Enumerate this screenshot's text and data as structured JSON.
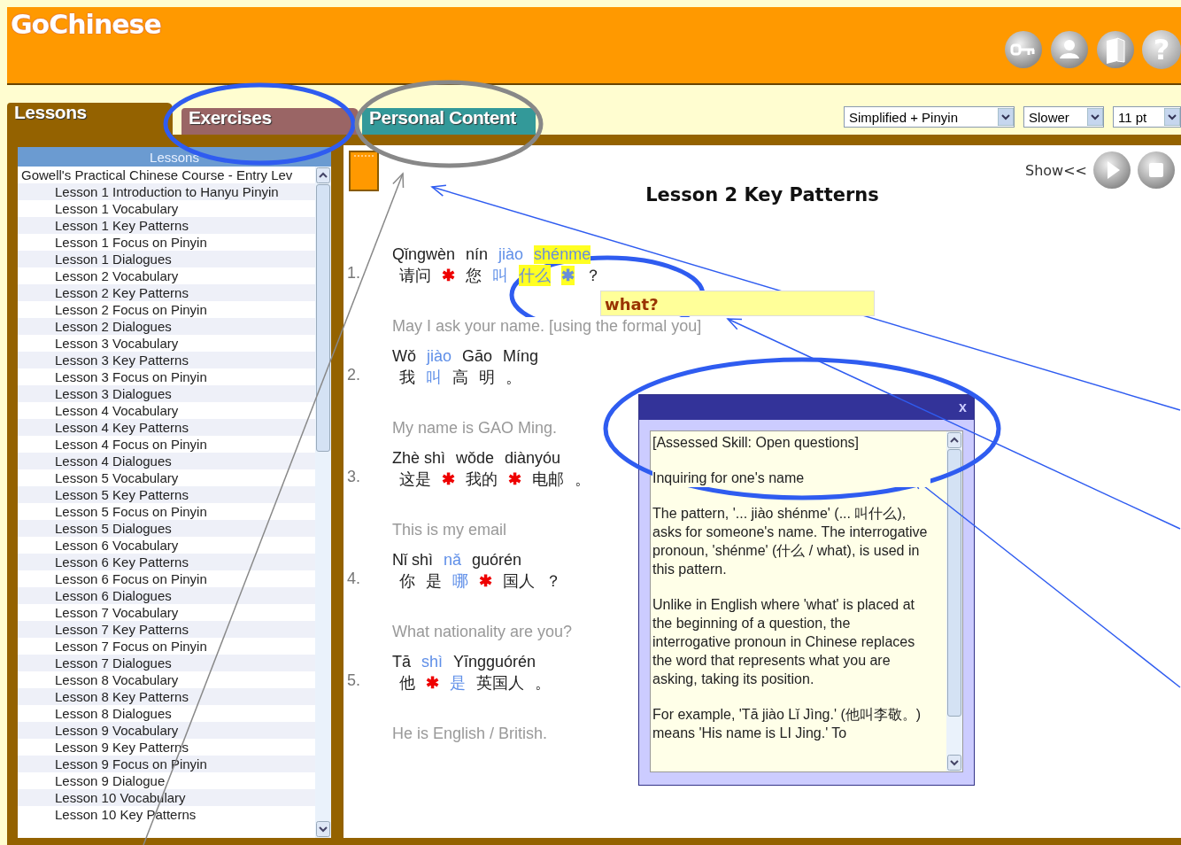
{
  "app": {
    "logo": "GoChinese",
    "help_button": "?"
  },
  "tabs": [
    {
      "label": "Lessons",
      "selected": true,
      "color": "#946200"
    },
    {
      "label": "Exercises",
      "selected": false,
      "color": "#9a6565"
    },
    {
      "label": "Personal Content",
      "selected": false,
      "color": "#339999"
    }
  ],
  "settings": [
    {
      "value": "Simplified + Pinyin"
    },
    {
      "value": "Slower"
    },
    {
      "value": "11 pt"
    }
  ],
  "sidebar": {
    "title": "Lessons",
    "items": [
      {
        "label": "Gowell's Practical Chinese Course - Entry Lev",
        "children": [
          {
            "label": "Lesson 1 Introduction to Hanyu Pinyin"
          },
          {
            "label": "Lesson 1 Vocabulary"
          },
          {
            "label": "Lesson 1 Key Patterns"
          },
          {
            "label": "Lesson 1 Focus on Pinyin"
          },
          {
            "label": "Lesson 1 Dialogues"
          },
          {
            "label": "Lesson 2 Vocabulary"
          },
          {
            "label": "Lesson 2 Key Patterns"
          },
          {
            "label": "Lesson 2 Focus on Pinyin"
          },
          {
            "label": "Lesson 2 Dialogues"
          },
          {
            "label": "Lesson 3 Vocabulary"
          },
          {
            "label": "Lesson 3 Key Patterns"
          },
          {
            "label": "Lesson 3 Focus on Pinyin"
          },
          {
            "label": "Lesson 3 Dialogues"
          },
          {
            "label": "Lesson 4 Vocabulary"
          },
          {
            "label": "Lesson 4 Key Patterns"
          },
          {
            "label": "Lesson 4 Focus on Pinyin"
          },
          {
            "label": "Lesson 4 Dialogues"
          },
          {
            "label": "Lesson 5 Vocabulary"
          },
          {
            "label": "Lesson 5 Key Patterns"
          },
          {
            "label": "Lesson 5 Focus on Pinyin"
          },
          {
            "label": "Lesson 5 Dialogues"
          },
          {
            "label": "Lesson 6 Vocabulary"
          },
          {
            "label": "Lesson 6 Key Patterns"
          },
          {
            "label": "Lesson 6 Focus on Pinyin"
          },
          {
            "label": "Lesson 6 Dialogues"
          },
          {
            "label": "Lesson 7 Vocabulary"
          },
          {
            "label": "Lesson 7 Key Patterns"
          },
          {
            "label": "Lesson 7 Focus on Pinyin"
          },
          {
            "label": "Lesson 7 Dialogues"
          },
          {
            "label": "Lesson 8 Vocabulary"
          },
          {
            "label": "Lesson 8 Key Patterns"
          },
          {
            "label": "Lesson 8 Dialogues"
          },
          {
            "label": "Lesson 9 Vocabulary"
          },
          {
            "label": "Lesson 9 Key Patterns"
          },
          {
            "label": "Lesson 9 Focus on Pinyin"
          },
          {
            "label": "Lesson 9 Dialogue"
          },
          {
            "label": "Lesson 10 Vocabulary"
          },
          {
            "label": "Lesson 10 Key Patterns"
          }
        ]
      }
    ]
  },
  "content": {
    "show_label": "Show<<",
    "title": "Lesson 2 Key Patterns",
    "sentences": [
      {
        "number": "1.",
        "pinyin": [
          {
            "text": "Qǐngwèn",
            "kind": "word",
            "selected": false
          },
          {
            "text": "nín",
            "kind": "word",
            "selected": false
          },
          {
            "text": "jiào",
            "kind": "linked",
            "selected": false
          },
          {
            "text": "shénme",
            "kind": "linked",
            "selected": true
          }
        ],
        "hanzi": [
          {
            "text": "请问",
            "kind": "word",
            "selected": false
          },
          {
            "text": "✱",
            "kind": "marker",
            "selected": false
          },
          {
            "text": "您",
            "kind": "word",
            "selected": false
          },
          {
            "text": "叫",
            "kind": "linked",
            "selected": false
          },
          {
            "text": "什么",
            "kind": "linked",
            "selected": true
          },
          {
            "text": "✱",
            "kind": "marker",
            "selected": true
          },
          {
            "text": "？",
            "kind": "word",
            "selected": false
          }
        ],
        "translation": "May I ask your name. [using the formal you]"
      },
      {
        "number": "2.",
        "pinyin": [
          {
            "text": "Wǒ",
            "kind": "word",
            "selected": false
          },
          {
            "text": "jiào",
            "kind": "linked",
            "selected": false
          },
          {
            "text": "Gāo",
            "kind": "word",
            "selected": false
          },
          {
            "text": "Míng",
            "kind": "word",
            "selected": false
          }
        ],
        "hanzi": [
          {
            "text": "我",
            "kind": "word",
            "selected": false
          },
          {
            "text": "叫",
            "kind": "linked",
            "selected": false
          },
          {
            "text": "高",
            "kind": "word",
            "selected": false
          },
          {
            "text": "明",
            "kind": "word",
            "selected": false
          },
          {
            "text": "。",
            "kind": "word",
            "selected": false
          }
        ],
        "translation": "My name is GAO Ming."
      },
      {
        "number": "3.",
        "pinyin": [
          {
            "text": "Zhè shì",
            "kind": "word",
            "selected": false
          },
          {
            "text": "wǒde",
            "kind": "word",
            "selected": false
          },
          {
            "text": "diànyóu",
            "kind": "word",
            "selected": false
          }
        ],
        "hanzi": [
          {
            "text": "这是",
            "kind": "word",
            "selected": false
          },
          {
            "text": "✱",
            "kind": "marker",
            "selected": false
          },
          {
            "text": "我的",
            "kind": "word",
            "selected": false
          },
          {
            "text": "✱",
            "kind": "marker",
            "selected": false
          },
          {
            "text": "电邮",
            "kind": "word",
            "selected": false
          },
          {
            "text": "。",
            "kind": "word",
            "selected": false
          }
        ],
        "translation": "This is my email"
      },
      {
        "number": "4.",
        "pinyin": [
          {
            "text": "Nǐ shì",
            "kind": "word",
            "selected": false
          },
          {
            "text": "nǎ",
            "kind": "linked",
            "selected": false
          },
          {
            "text": "guórén",
            "kind": "word",
            "selected": false
          }
        ],
        "hanzi": [
          {
            "text": "你",
            "kind": "word",
            "selected": false
          },
          {
            "text": "是",
            "kind": "word",
            "selected": false
          },
          {
            "text": "哪",
            "kind": "linked",
            "selected": false
          },
          {
            "text": "✱",
            "kind": "marker",
            "selected": false
          },
          {
            "text": "国人",
            "kind": "word",
            "selected": false
          },
          {
            "text": "？",
            "kind": "word",
            "selected": false
          }
        ],
        "translation": "What nationality are you?"
      },
      {
        "number": "5.",
        "pinyin": [
          {
            "text": "Tā",
            "kind": "word",
            "selected": false
          },
          {
            "text": "shì",
            "kind": "linked",
            "selected": false
          },
          {
            "text": "Yīngguórén",
            "kind": "word",
            "selected": false
          }
        ],
        "hanzi": [
          {
            "text": "他",
            "kind": "word",
            "selected": false
          },
          {
            "text": "✱",
            "kind": "marker",
            "selected": false
          },
          {
            "text": "是",
            "kind": "linked",
            "selected": false
          },
          {
            "text": "英国人",
            "kind": "word",
            "selected": false
          },
          {
            "text": "。",
            "kind": "word",
            "selected": false
          }
        ],
        "translation": "He is English / British."
      }
    ],
    "tooltip": "what?",
    "popup": {
      "close": "x",
      "paragraphs": [
        "[Assessed Skill: Open questions]",
        "Inquiring for one's name",
        "The pattern, '... jiào shénme' (... 叫什么), asks for someone's name. The interrogative pronoun, 'shénme' (什么 / what), is used in this pattern.",
        "Unlike in English where 'what' is placed at the beginning of a question, the interrogative pronoun in Chinese replaces the word that represents what you are asking, taking its position.",
        "For example, 'Tā jiào Lǐ Jìng.' (他叫李敬。) means 'His name is LI Jing.' To"
      ]
    }
  }
}
